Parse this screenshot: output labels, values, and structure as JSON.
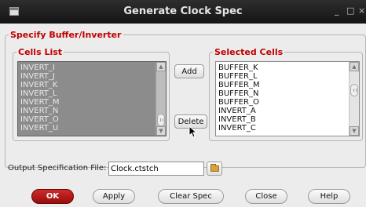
{
  "window": {
    "title": "Generate Clock Spec",
    "minimize": "_",
    "maximize": "□",
    "close": "×"
  },
  "specify_group": {
    "legend": "Specify Buffer/Inverter"
  },
  "cells_list": {
    "legend": "Cells List",
    "items": [
      "INVERT_I",
      "INVERT_J",
      "INVERT_K",
      "INVERT_L",
      "INVERT_M",
      "INVERT_N",
      "INVERT_O",
      "INVERT_U"
    ]
  },
  "selected_cells": {
    "legend": "Selected Cells",
    "items": [
      "BUFFER_K",
      "BUFFER_L",
      "BUFFER_M",
      "BUFFER_N",
      "BUFFER_O",
      "INVERT_A",
      "INVERT_B",
      "INVERT_C"
    ]
  },
  "buttons": {
    "add": "Add",
    "delete": "Delete",
    "ok": "OK",
    "apply": "Apply",
    "clear_spec": "Clear Spec",
    "close": "Close",
    "help": "Help"
  },
  "output": {
    "label": "Output Specification File:",
    "value": "Clock.ctstch"
  },
  "icons": {
    "window": "window-icon",
    "browse": "folder-icon",
    "cursor": "mouse-pointer-icon"
  },
  "colors": {
    "legend": "#c00000",
    "ok_button": "#b81c1c",
    "titlebar": "#1e1e1e",
    "cells_list_bg": "#8c8c8c"
  }
}
